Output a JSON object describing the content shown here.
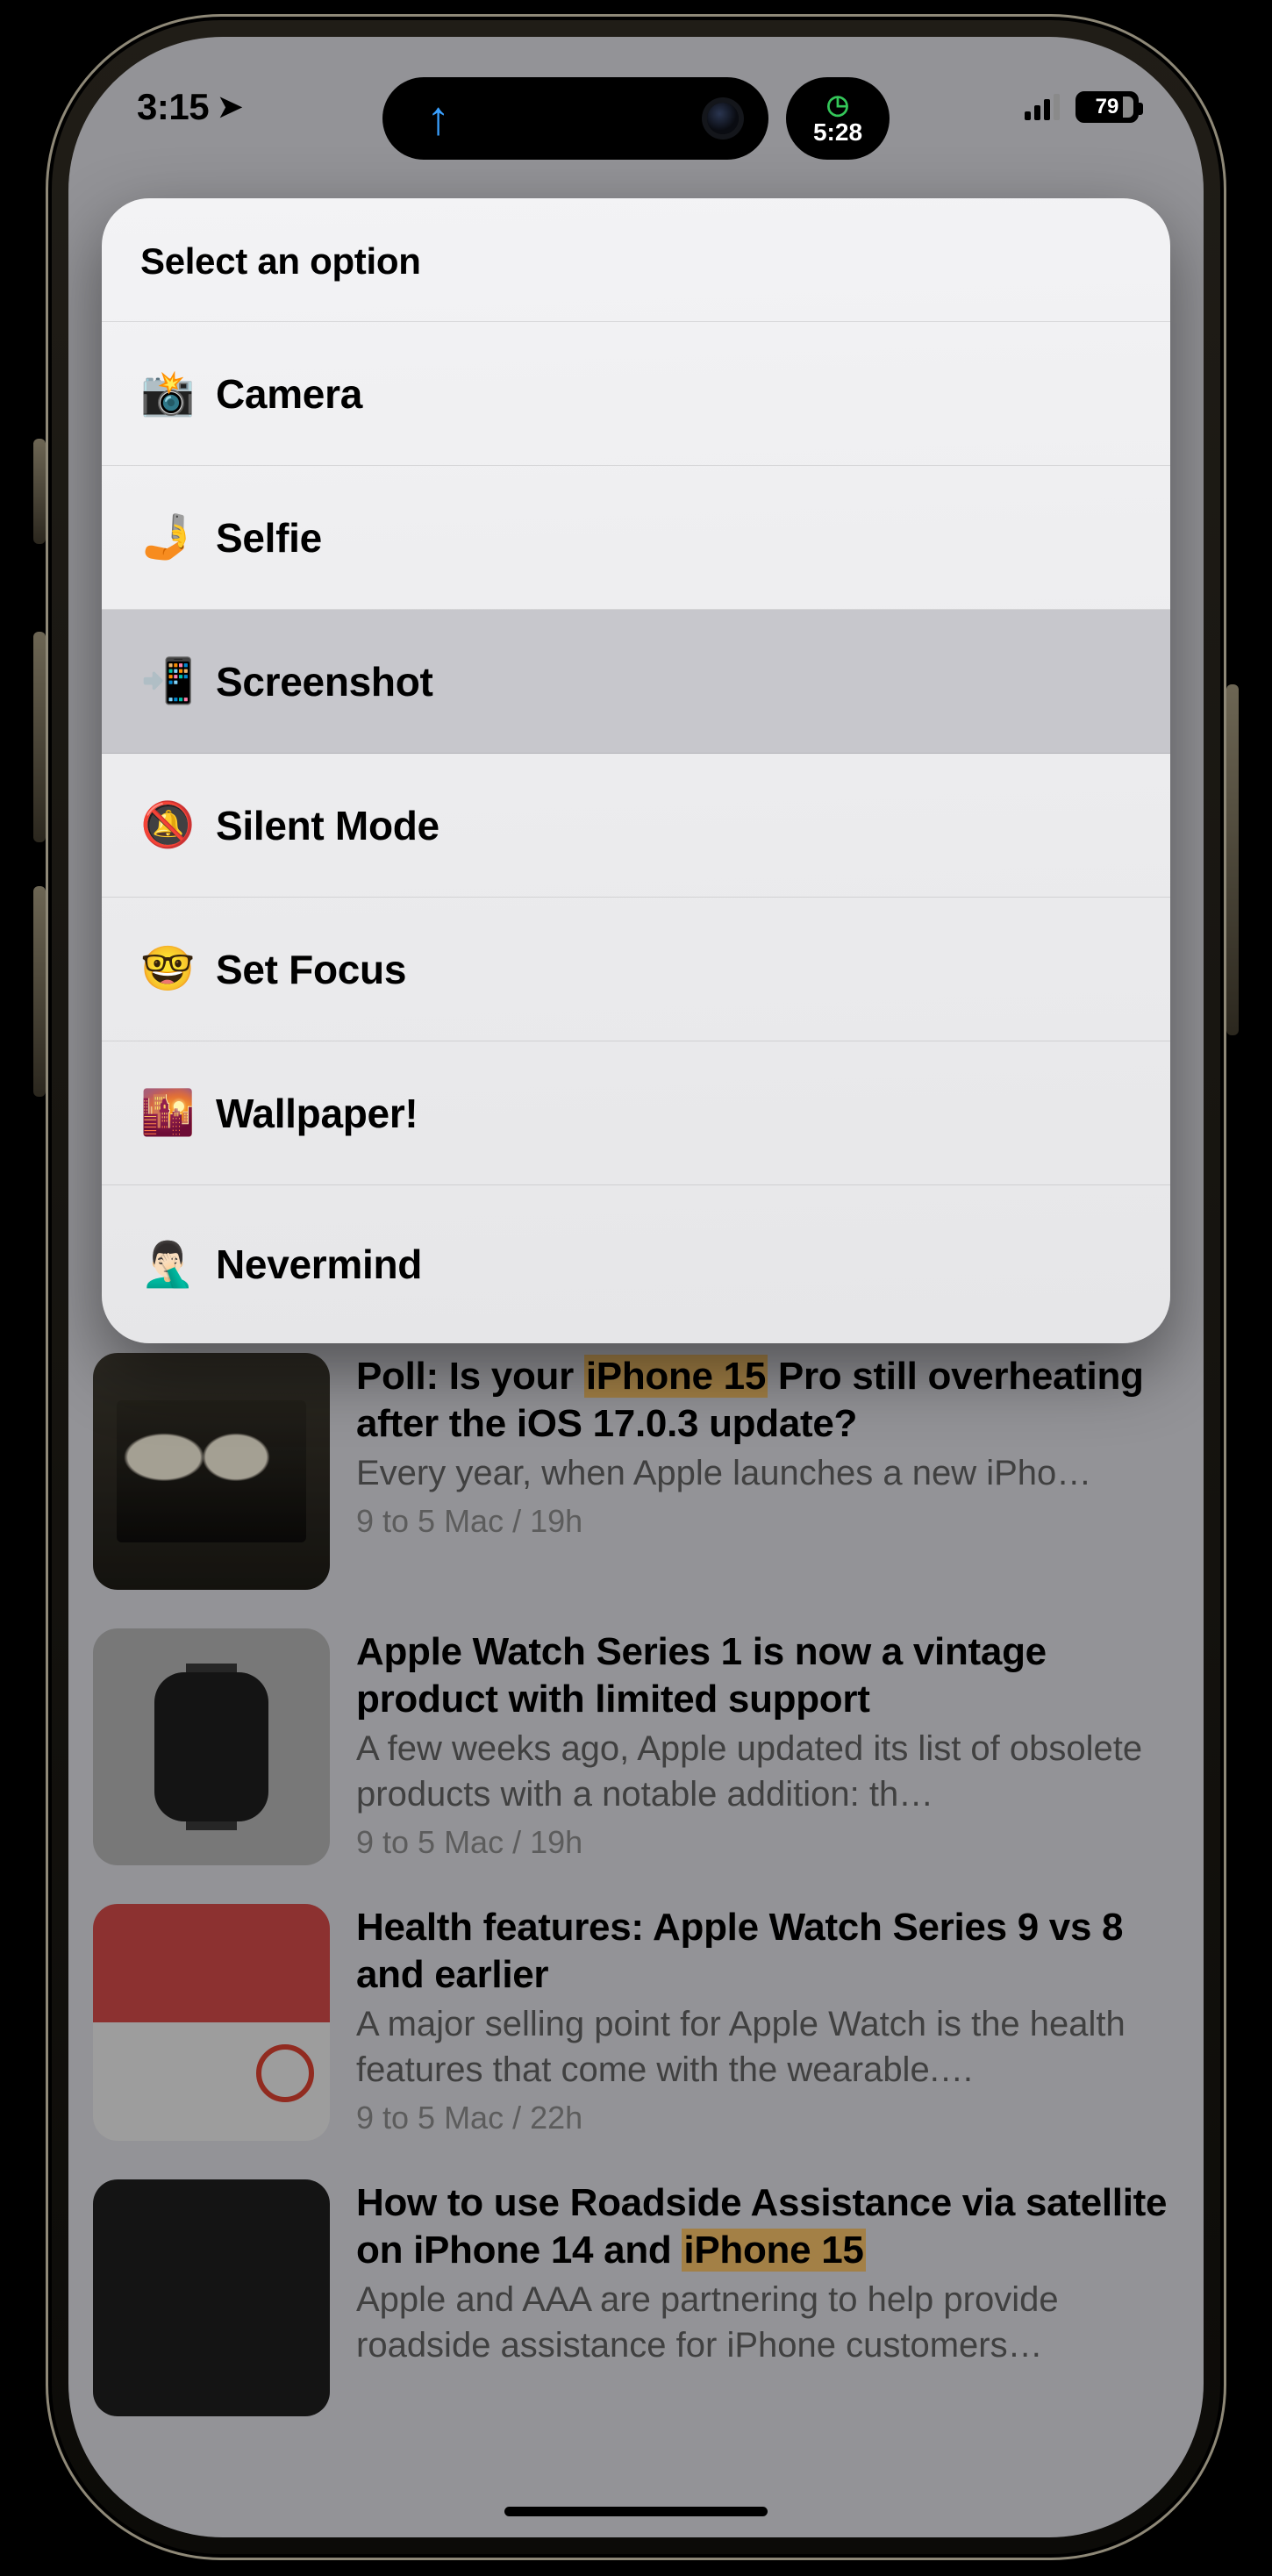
{
  "status": {
    "time": "3:15",
    "live_activity": "5:28",
    "battery": "79"
  },
  "sheet": {
    "title": "Select an option",
    "items": [
      {
        "emoji": "📸",
        "label": "Camera",
        "pressed": false
      },
      {
        "emoji": "🤳",
        "label": "Selfie",
        "pressed": false
      },
      {
        "emoji": "📲",
        "label": "Screenshot",
        "pressed": true
      },
      {
        "emoji": "🔕",
        "label": "Silent Mode",
        "pressed": false
      },
      {
        "emoji": "🤓",
        "label": "Set Focus",
        "pressed": false
      },
      {
        "emoji": "🌇",
        "label": "Wallpaper!",
        "pressed": false
      },
      {
        "emoji": "🤦🏻‍♂️",
        "label": "Nevermind",
        "pressed": false
      }
    ]
  },
  "feed": [
    {
      "headline_pre": "Poll: Is your ",
      "headline_hl": "iPhone 15",
      "headline_post": " Pro still overheating after the iOS 17.0.3 update?",
      "excerpt": "Every year, when Apple launches a new iPho…",
      "meta": "9 to 5 Mac / 19h",
      "thumb": "stove"
    },
    {
      "headline_pre": "Apple Watch Series 1 is now a vintage product with limited support",
      "headline_hl": "",
      "headline_post": "",
      "excerpt": "A few weeks ago, Apple updated its list of obsolete products with a notable addition: th…",
      "meta": "9 to 5 Mac / 19h",
      "thumb": "watch1"
    },
    {
      "headline_pre": "Health features: Apple Watch Series 9 vs 8 and earlier",
      "headline_hl": "",
      "headline_post": "",
      "excerpt": "A major selling point for Apple Watch is the health features that come with the wearable.…",
      "meta": "9 to 5 Mac / 22h",
      "thumb": "watch2"
    },
    {
      "headline_pre": "How to use Roadside Assistance via satellite on iPhone 14 and ",
      "headline_hl": "iPhone 15",
      "headline_post": "",
      "excerpt": "Apple and AAA are partnering to help provide roadside assistance for iPhone customers…",
      "meta": "",
      "thumb": "road"
    }
  ]
}
